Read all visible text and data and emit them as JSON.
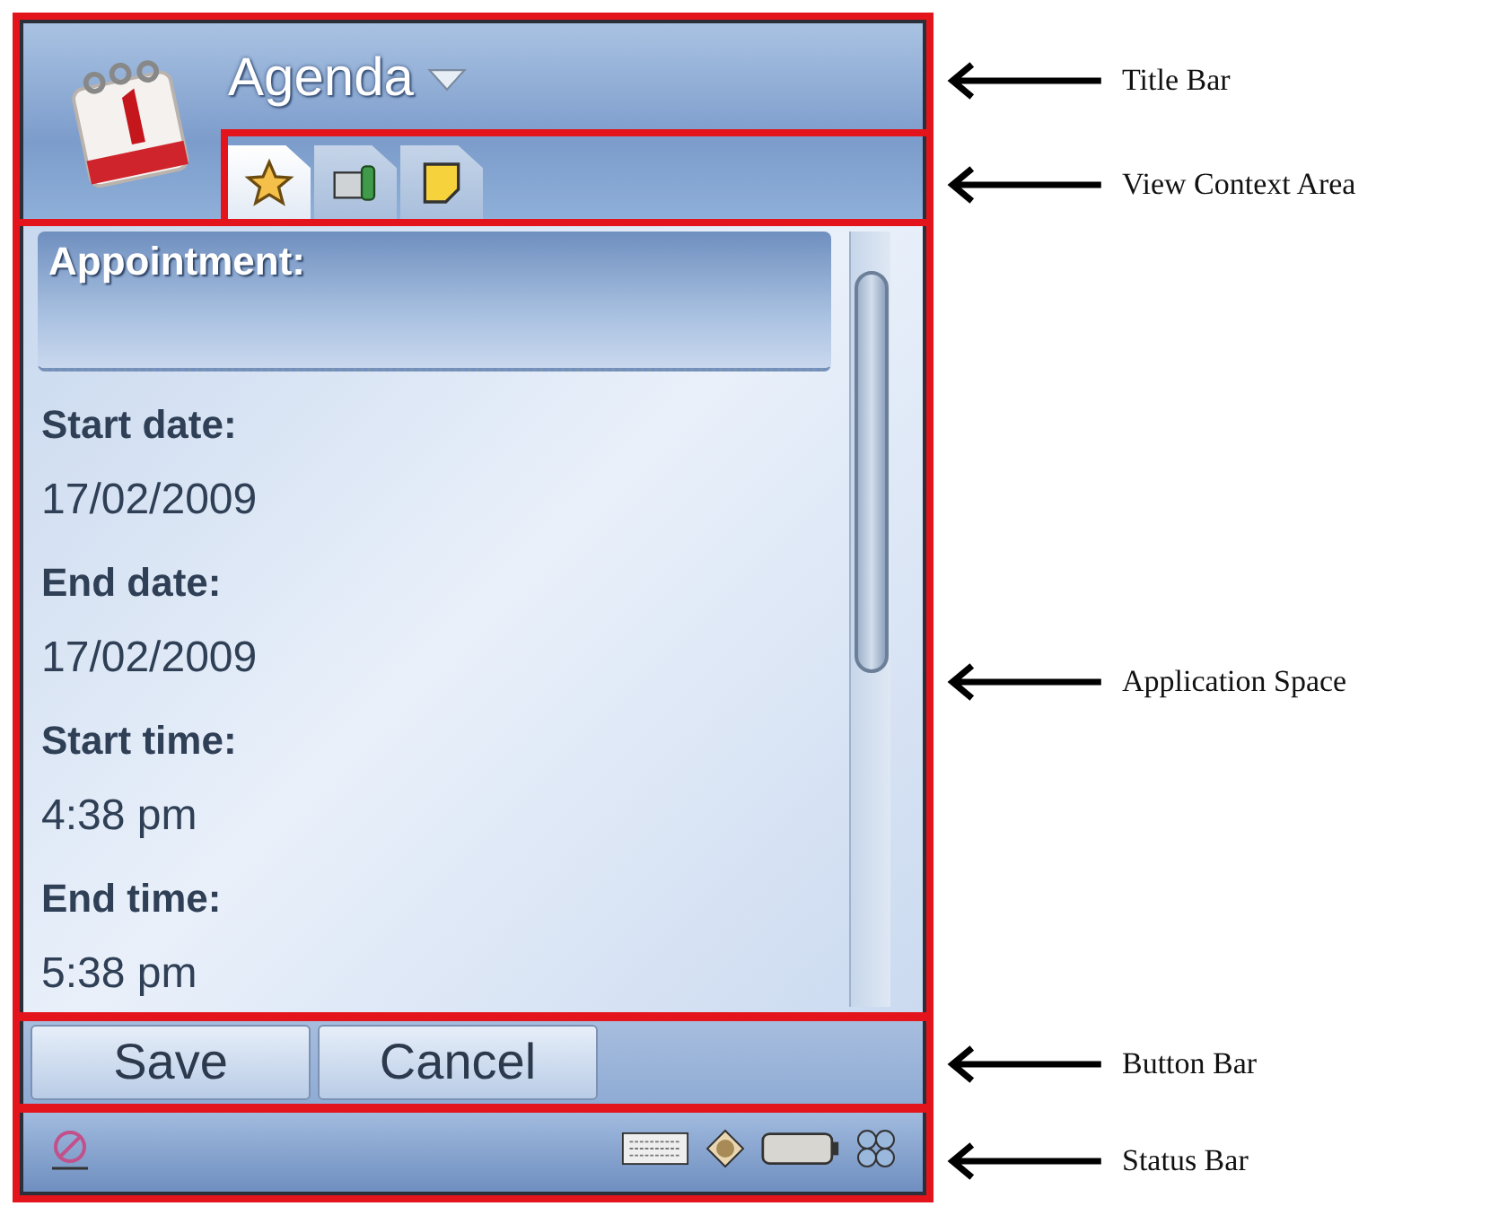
{
  "title_bar": {
    "title": "Agenda"
  },
  "tabs": [
    {
      "selected": true
    },
    {
      "selected": false
    },
    {
      "selected": false
    }
  ],
  "application_space": {
    "heading": "Appointment:",
    "fields": [
      {
        "label": "Start date:",
        "value": "17/02/2009"
      },
      {
        "label": "End date:",
        "value": "17/02/2009"
      },
      {
        "label": "Start time:",
        "value": "4:38 pm"
      },
      {
        "label": "End time:",
        "value": "5:38 pm"
      }
    ]
  },
  "buttons": [
    "Save",
    "Cancel"
  ],
  "annotations": [
    "Title Bar",
    "View Context Area",
    "Application Space",
    "Button Bar",
    "Status Bar"
  ]
}
